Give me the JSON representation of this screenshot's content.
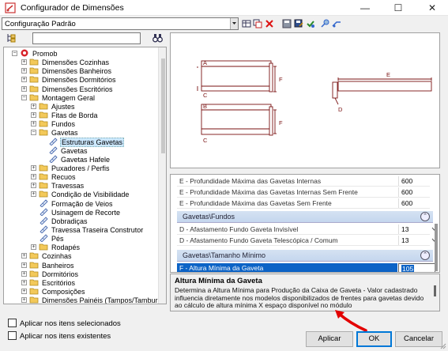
{
  "window": {
    "title": "Configurador de Dimensões",
    "minimize_glyph": "—",
    "maximize_glyph": "☐",
    "close_glyph": "✕"
  },
  "config_combo": {
    "value": "Configuração Padrão"
  },
  "toolbar": {
    "icons": [
      "grid-icon",
      "copy-icon",
      "delete-icon",
      "save-icon",
      "save-as-icon",
      "check-icon",
      "pin-icon",
      "transfer-icon"
    ]
  },
  "tree": {
    "nodes": [
      {
        "label": "Promob",
        "level": 0,
        "expander": "−",
        "icon": "promob-logo-icon"
      },
      {
        "label": "Dimensões Cozinhas",
        "level": 1,
        "expander": "+",
        "icon": "folder-icon"
      },
      {
        "label": "Dimensões Banheiros",
        "level": 1,
        "expander": "+",
        "icon": "folder-icon"
      },
      {
        "label": "Dimensões Dormitórios",
        "level": 1,
        "expander": "+",
        "icon": "folder-icon"
      },
      {
        "label": "Dimensões Escritórios",
        "level": 1,
        "expander": "+",
        "icon": "folder-icon"
      },
      {
        "label": "Montagem Geral",
        "level": 1,
        "expander": "−",
        "icon": "folder-icon"
      },
      {
        "label": "Ajustes",
        "level": 2,
        "expander": "+",
        "icon": "folder-icon"
      },
      {
        "label": "Fitas de Borda",
        "level": 2,
        "expander": "+",
        "icon": "folder-icon"
      },
      {
        "label": "Fundos",
        "level": 2,
        "expander": "+",
        "icon": "folder-icon"
      },
      {
        "label": "Gavetas",
        "level": 2,
        "expander": "−",
        "icon": "folder-icon"
      },
      {
        "label": "Estruturas Gavetas",
        "level": 3,
        "expander": "",
        "icon": "ruler-icon",
        "selected": true
      },
      {
        "label": "Gavetas",
        "level": 3,
        "expander": "",
        "icon": "ruler-icon"
      },
      {
        "label": "Gavetas Hafele",
        "level": 3,
        "expander": "",
        "icon": "ruler-icon"
      },
      {
        "label": "Puxadores / Perfis",
        "level": 2,
        "expander": "+",
        "icon": "folder-icon"
      },
      {
        "label": "Recuos",
        "level": 2,
        "expander": "+",
        "icon": "folder-icon"
      },
      {
        "label": "Travessas",
        "level": 2,
        "expander": "+",
        "icon": "folder-icon"
      },
      {
        "label": "Condição de Visibilidade",
        "level": 2,
        "expander": "+",
        "icon": "folder-icon"
      },
      {
        "label": "Formação de Veios",
        "level": 2,
        "expander": "",
        "icon": "ruler-icon"
      },
      {
        "label": "Usinagem de Recorte",
        "level": 2,
        "expander": "",
        "icon": "ruler-icon"
      },
      {
        "label": "Dobradiças",
        "level": 2,
        "expander": "",
        "icon": "ruler-icon"
      },
      {
        "label": "Travessa Traseira Construtor",
        "level": 2,
        "expander": "",
        "icon": "ruler-icon"
      },
      {
        "label": "Pés",
        "level": 2,
        "expander": "",
        "icon": "ruler-icon"
      },
      {
        "label": "Rodapés",
        "level": 2,
        "expander": "+",
        "icon": "folder-icon"
      },
      {
        "label": "Cozinhas",
        "level": 1,
        "expander": "+",
        "icon": "folder-icon"
      },
      {
        "label": "Banheiros",
        "level": 1,
        "expander": "+",
        "icon": "folder-icon"
      },
      {
        "label": "Dormitórios",
        "level": 1,
        "expander": "+",
        "icon": "folder-icon"
      },
      {
        "label": "Escritórios",
        "level": 1,
        "expander": "+",
        "icon": "folder-icon"
      },
      {
        "label": "Composições",
        "level": 1,
        "expander": "+",
        "icon": "folder-icon"
      },
      {
        "label": "Dimensões Painéis (Tampos/Tamburatos",
        "level": 1,
        "expander": "+",
        "icon": "folder-icon"
      }
    ]
  },
  "preview": {
    "labels": {
      "A": "A",
      "B": "B",
      "C1": "C",
      "C2": "C",
      "D": "D",
      "E": "E",
      "F1": "F",
      "F2": "F"
    }
  },
  "properties": {
    "rows_top": [
      {
        "name": "E - Profundidade Máxima das Gavetas Internas",
        "value": "600"
      },
      {
        "name": "E - Profundidade Máxima das Gavetas Internas Sem Frente",
        "value": "600"
      },
      {
        "name": "E - Profundidade Máxima das Gavetas Sem Frente",
        "value": "600"
      }
    ],
    "section_fundos": "Gavetas\\Fundos",
    "rows_fundos": [
      {
        "name": "D - Afastamento Fundo Gaveta Invisível",
        "value": "13"
      },
      {
        "name": "D - Afastamento Fundo Gaveta Telescópica / Comum",
        "value": "13"
      }
    ],
    "section_tamanho": "Gavetas\\Tamanho Mínimo",
    "row_selected": {
      "name": "F - Altura Mínima da Gaveta",
      "value": "105"
    },
    "collapse_glyph": "⌃"
  },
  "description": {
    "title": "Altura Mínima da Gaveta",
    "text": "Determina a Altura Mínima para Produção da Caixa de Gaveta - Valor cadastrado influencia diretamente nos modelos disponibilizados de frentes para gavetas devido ao cálculo de altura mínima X espaço disponível no módulo"
  },
  "options": {
    "apply_selected": "Aplicar nos itens selecionados",
    "apply_existing": "Aplicar nos itens existentes"
  },
  "buttons": {
    "apply": "Aplicar",
    "ok": "OK",
    "cancel": "Cancelar"
  },
  "colors": {
    "selection": "#0c63c6",
    "annotation_arrow": "#e30000",
    "drawing_line": "#7a1212"
  }
}
